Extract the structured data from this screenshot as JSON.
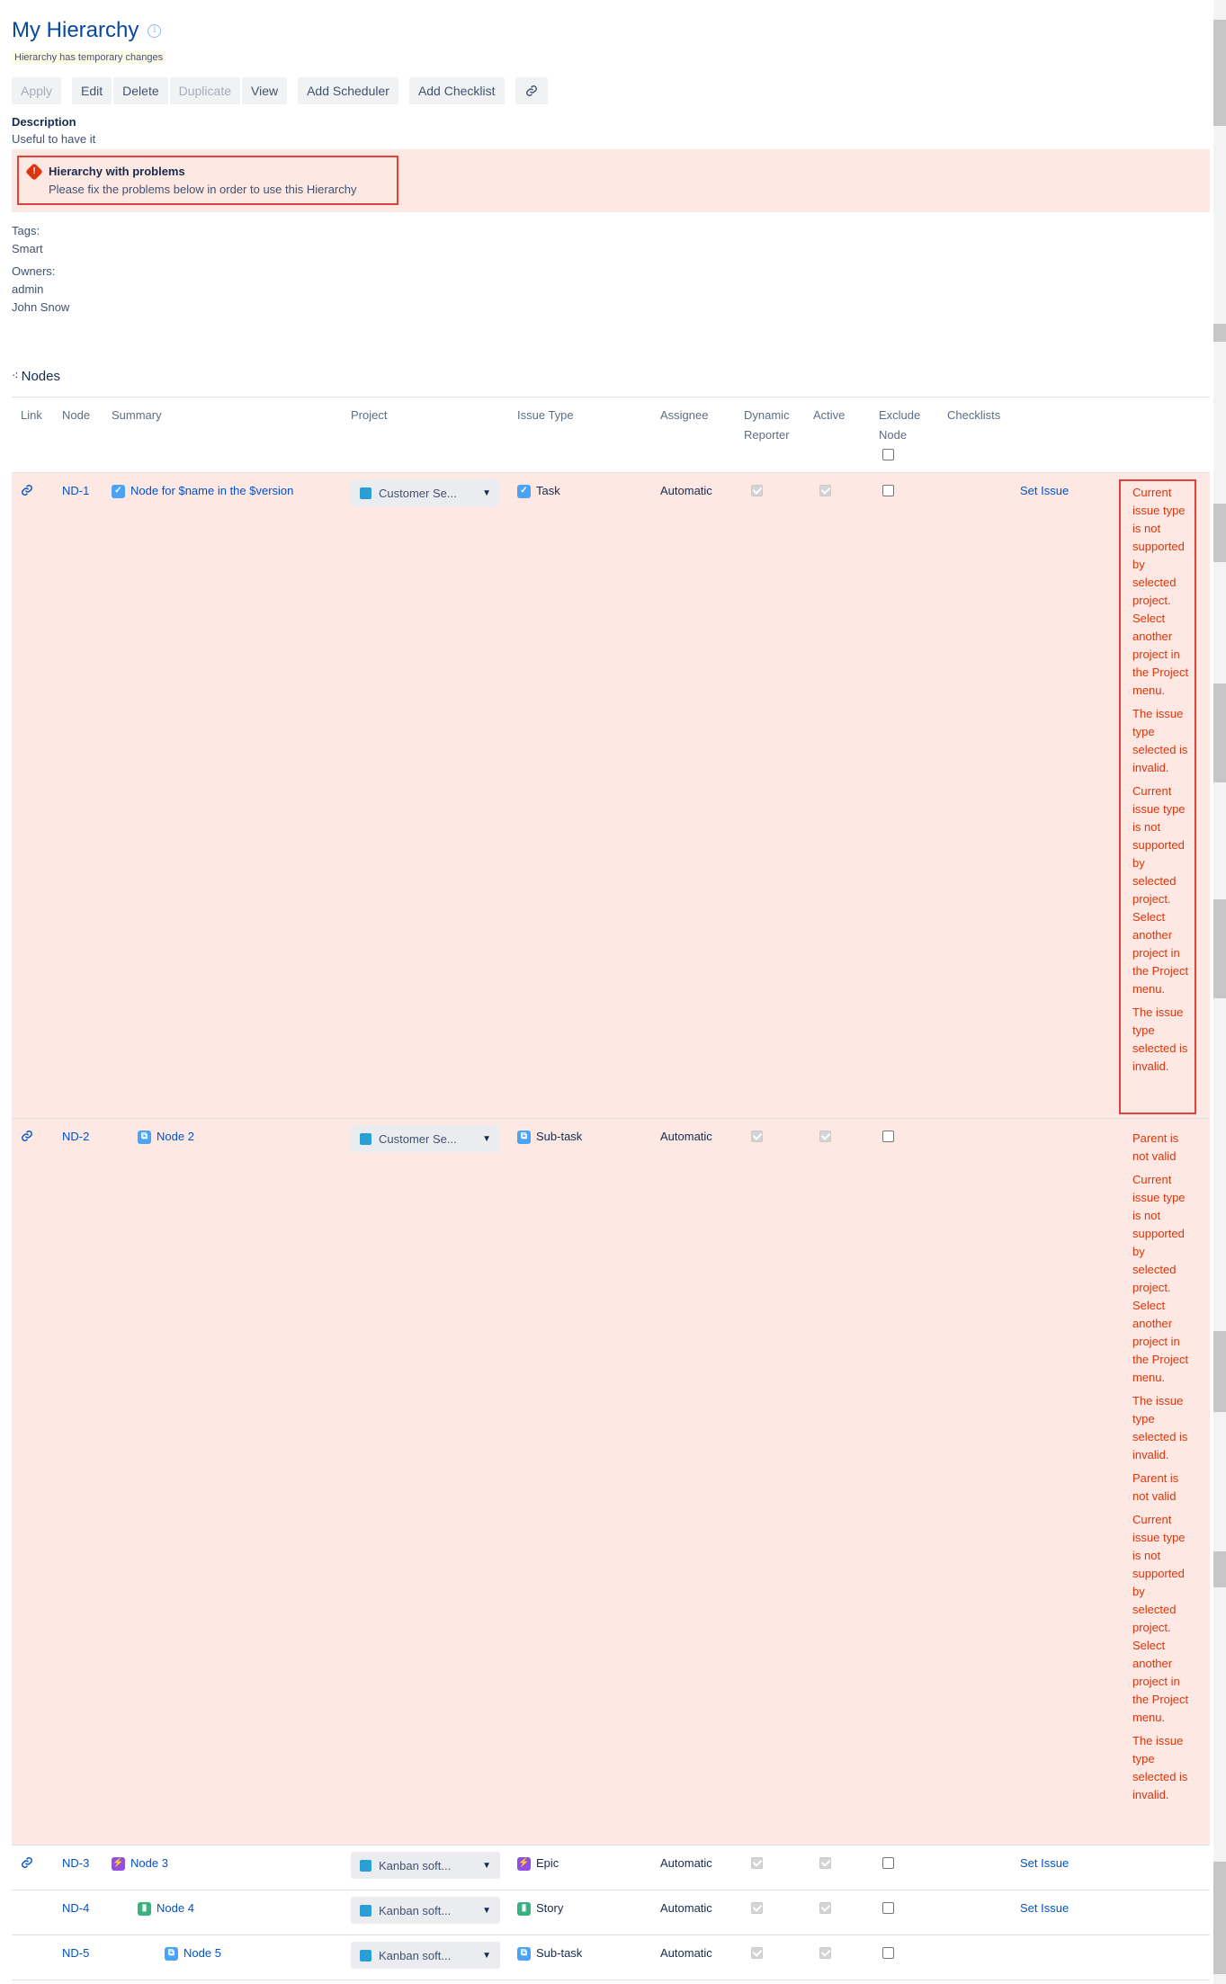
{
  "header": {
    "title": "My Hierarchy",
    "temp_note": "Hierarchy has temporary changes"
  },
  "toolbar": {
    "apply": "Apply",
    "edit": "Edit",
    "delete": "Delete",
    "duplicate": "Duplicate",
    "view": "View",
    "add_scheduler": "Add Scheduler",
    "add_checklist": "Add Checklist"
  },
  "description": {
    "label": "Description",
    "text": "Useful to have it"
  },
  "problem": {
    "title": "Hierarchy with problems",
    "text": "Please fix the problems below in order to use this Hierarchy"
  },
  "tags": {
    "label": "Tags:",
    "values": [
      "Smart"
    ]
  },
  "owners": {
    "label": "Owners:",
    "values": [
      "admin",
      "John Snow"
    ]
  },
  "nodes_heading": "Nodes",
  "columns": {
    "link": "Link",
    "node": "Node",
    "summary": "Summary",
    "project": "Project",
    "issue_type": "Issue Type",
    "assignee": "Assignee",
    "dynamic_reporter": "Dynamic Reporter",
    "active": "Active",
    "exclude_node": "Exclude Node",
    "checklists": "Checklists"
  },
  "rows": [
    {
      "id": "ND-1",
      "summary": "Node for $name in the $version",
      "summary_icon": "task-icon",
      "project": "Customer Se...",
      "issue_type": "Task",
      "issue_type_icon": "task-icon",
      "assignee": "Automatic",
      "action": "Set Issue",
      "errors": [
        "Current issue type is not supported by selected project. Select another project in the Project menu.",
        "The issue type selected is invalid.",
        "Current issue type is not supported by selected project. Select another project in the Project menu.",
        "The issue type selected is invalid."
      ]
    },
    {
      "id": "ND-2",
      "summary": "Node 2",
      "summary_icon": "subtask-icon",
      "project": "Customer Se...",
      "issue_type": "Sub-task",
      "issue_type_icon": "subtask-icon",
      "assignee": "Automatic",
      "action": "",
      "errors": [
        "Parent is not valid",
        "Current issue type is not supported by selected project. Select another project in the Project menu.",
        "The issue type selected is invalid.",
        "Parent is not valid",
        "Current issue type is not supported by selected project. Select another project in the Project menu.",
        "The issue type selected is invalid."
      ]
    },
    {
      "id": "ND-3",
      "summary": "Node 3",
      "summary_icon": "epic-icon",
      "project": "Kanban soft...",
      "issue_type": "Epic",
      "issue_type_icon": "epic-icon",
      "assignee": "Automatic",
      "action": "Set Issue",
      "errors": []
    },
    {
      "id": "ND-4",
      "summary": "Node 4",
      "summary_icon": "story-icon",
      "project": "Kanban soft...",
      "issue_type": "Story",
      "issue_type_icon": "story-icon",
      "assignee": "Automatic",
      "action": "Set Issue",
      "errors": []
    },
    {
      "id": "ND-5",
      "summary": "Node 5",
      "summary_icon": "subtask-icon",
      "project": "Kanban soft...",
      "issue_type": "Sub-task",
      "issue_type_icon": "subtask-icon",
      "assignee": "Automatic",
      "action": "",
      "errors": []
    }
  ],
  "colors": {
    "title": "#0747a6",
    "link": "#0052cc",
    "error": "#de350b",
    "error_bg": "#fde8e4"
  }
}
